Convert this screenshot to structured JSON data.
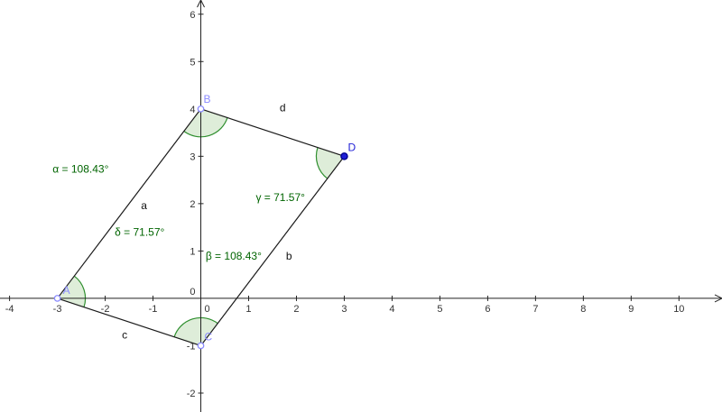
{
  "colors": {
    "axis": "#222222",
    "segment": "#1a1a1a",
    "angle_fill": "#d8ead2",
    "angle_stroke": "#2f8f2f",
    "angle_text": "#006400",
    "point_free": "#8a8aff",
    "point_dep": "#1f1fd6"
  },
  "axes": {
    "x_range": [
      -4.2,
      10.9
    ],
    "y_range": [
      -2.4,
      6.3
    ],
    "x_ticks": [
      "-4",
      "-3",
      "-2",
      "-1",
      "0",
      "1",
      "2",
      "3",
      "4",
      "5",
      "6",
      "7",
      "8",
      "9",
      "10"
    ],
    "y_ticks": [
      "-2",
      "-1",
      "0",
      "1",
      "2",
      "3",
      "4",
      "5",
      "6"
    ]
  },
  "points": [
    {
      "label": "A",
      "x": -3,
      "y": 0,
      "style": "free"
    },
    {
      "label": "B",
      "x": 0,
      "y": 4,
      "style": "free"
    },
    {
      "label": "C",
      "x": 0,
      "y": -1,
      "style": "free"
    },
    {
      "label": "D",
      "x": 3,
      "y": 3,
      "style": "dep"
    }
  ],
  "segments": [
    {
      "label": "a",
      "from": "A",
      "to": "B"
    },
    {
      "label": "d",
      "from": "B",
      "to": "D"
    },
    {
      "label": "b",
      "from": "D",
      "to": "C"
    },
    {
      "label": "c",
      "from": "C",
      "to": "A"
    }
  ],
  "angles": [
    {
      "label": "α = 108.43°",
      "vertex": "B"
    },
    {
      "label": "β = 108.43°",
      "vertex": "C"
    },
    {
      "label": "γ = 71.57°",
      "vertex": "D"
    },
    {
      "label": "δ = 71.57°",
      "vertex": "A"
    }
  ]
}
